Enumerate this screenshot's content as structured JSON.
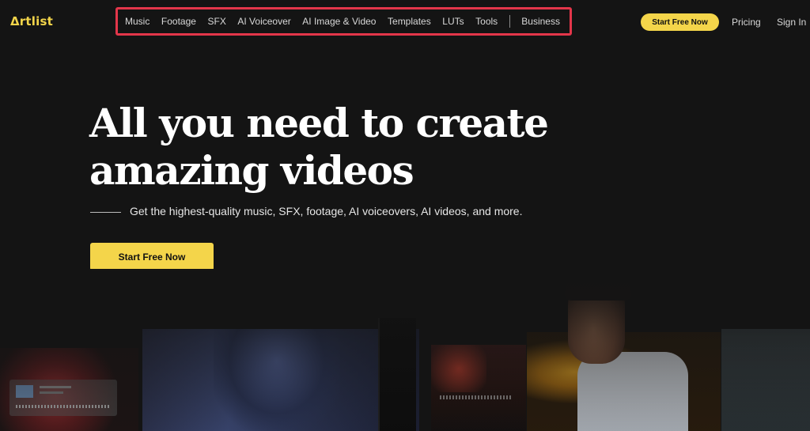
{
  "brand": {
    "logo_text": "Δrtlist",
    "accent_color": "#f4d54a"
  },
  "nav": {
    "items": [
      "Music",
      "Footage",
      "SFX",
      "AI Voiceover",
      "AI Image & Video",
      "Templates",
      "LUTs",
      "Tools"
    ],
    "business": "Business",
    "highlight_color": "#e3364a"
  },
  "header_right": {
    "start_free": "Start Free Now",
    "pricing": "Pricing",
    "sign_in": "Sign In"
  },
  "hero": {
    "headline_line1": "All you need to create",
    "headline_line2": "amazing videos",
    "subtitle": "Get the highest-quality music, SFX, footage, AI voiceovers, AI videos, and more.",
    "cta": "Start Free Now"
  }
}
